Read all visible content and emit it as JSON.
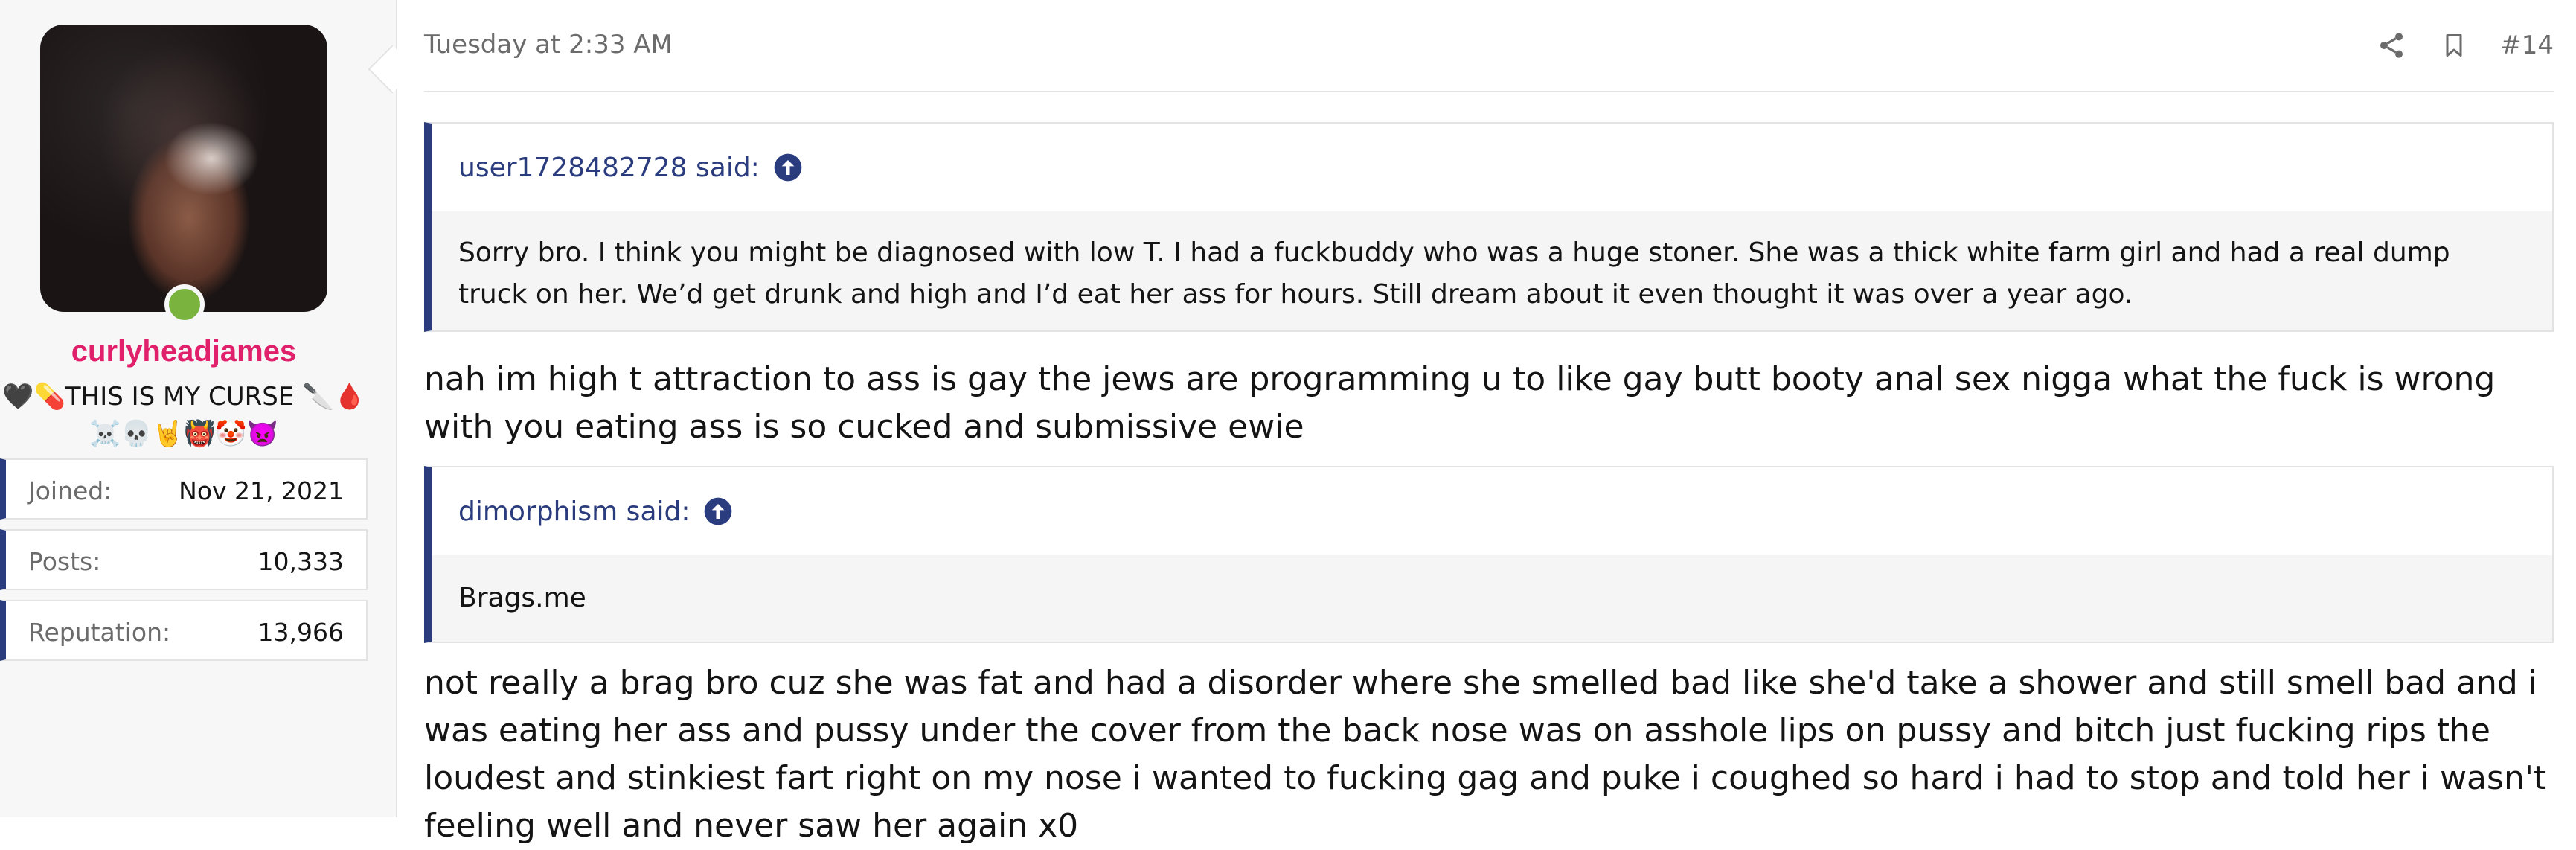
{
  "user": {
    "name": "curlyheadjames",
    "title_line1_prefix": "🖤💊",
    "title_line1_text": "THIS IS MY CURSE",
    "title_line1_suffix": "🔪🩸",
    "title_line2": "☠️💀🤘👹🤡👿",
    "online_color": "#7ab33e",
    "name_color": "#e0206a",
    "stats": [
      {
        "label": "Joined:",
        "value": "Nov 21, 2021"
      },
      {
        "label": "Posts:",
        "value": "10,333"
      },
      {
        "label": "Reputation:",
        "value": "13,966"
      }
    ]
  },
  "post": {
    "timestamp": "Tuesday at 2:33 AM",
    "number": "#14",
    "icons": [
      "share-icon",
      "bookmark-icon"
    ],
    "quote1": {
      "author": "user1728482728 said:",
      "text": "Sorry bro. I think you might be diagnosed with low T. I had a fuckbuddy who was a huge stoner. She was a thick white farm girl and had a real dump truck on her. We’d get drunk and high and I’d eat her ass for hours. Still dream about it even thought it was over a year ago."
    },
    "reply1": "nah im high t attraction to ass is gay the jews are programming u to like gay butt booty anal sex nigga what the fuck is wrong with you eating ass is so cucked and submissive ewie",
    "quote2": {
      "author": "dimorphism said:",
      "text": "Brags.me"
    },
    "reply2": "not really a brag bro cuz she was fat and had a disorder where she smelled bad like she'd take a shower and still smell bad and i was eating her ass and pussy under the cover from the back nose was on asshole lips on pussy and bitch just fucking rips the loudest and stinkiest fart right on my nose i wanted to fucking gag and puke i coughed so hard i had to stop and told her i wasn't feeling well and never saw her again x0"
  },
  "colors": {
    "accent": "#2b3c7e",
    "muted": "#6b6b6b",
    "border": "#e3e3e3",
    "sidebar_bg": "#f7f7f7"
  }
}
